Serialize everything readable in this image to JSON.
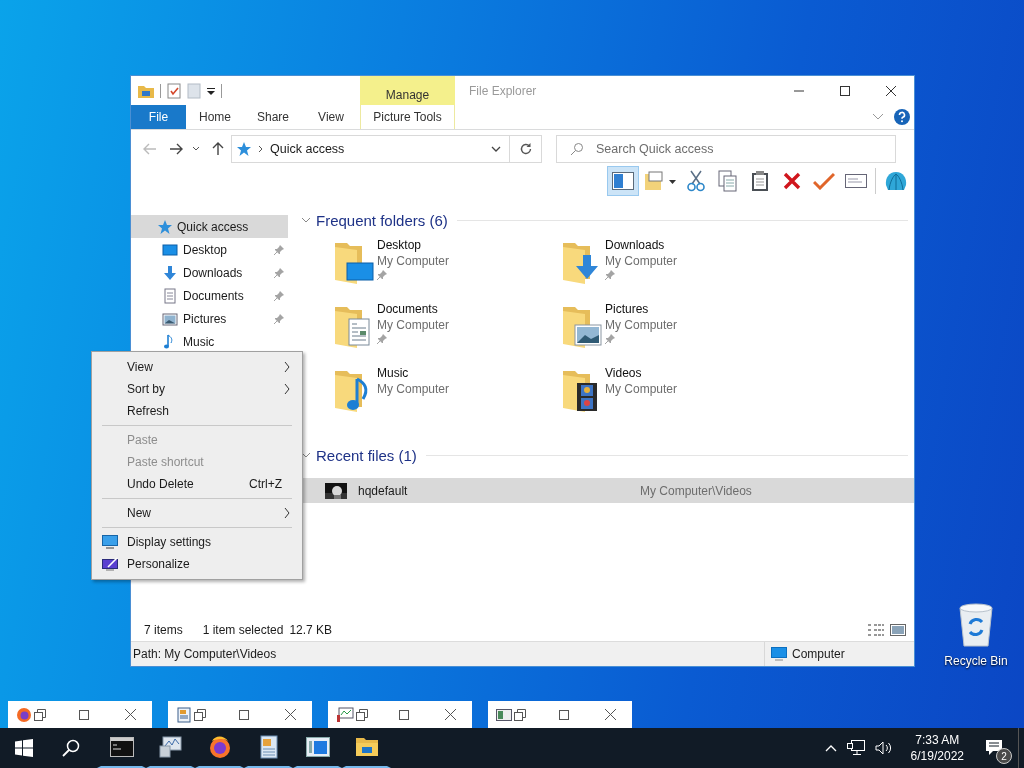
{
  "window": {
    "title": "File Explorer",
    "context_group": "Manage",
    "ribbon_tabs": [
      {
        "label": "File",
        "kind": "file"
      },
      {
        "label": "Home",
        "kind": "tab"
      },
      {
        "label": "Share",
        "kind": "tab"
      },
      {
        "label": "View",
        "kind": "tab"
      },
      {
        "label": "Picture Tools",
        "kind": "context"
      }
    ],
    "address": {
      "location": "Quick access"
    },
    "search": {
      "placeholder": "Search Quick access"
    },
    "sidebar": {
      "items": [
        {
          "label": "Quick access",
          "selected": true,
          "children": [
            {
              "label": "Desktop",
              "selected": false,
              "pinned": true
            },
            {
              "label": "Downloads",
              "selected": false,
              "pinned": true
            },
            {
              "label": "Documents",
              "selected": false,
              "pinned": true
            },
            {
              "label": "Pictures",
              "selected": false,
              "pinned": true
            },
            {
              "label": "Music",
              "selected": false
            }
          ]
        }
      ]
    },
    "frequent_folders": {
      "heading": "Frequent folders (6)",
      "items": [
        {
          "name": "Desktop",
          "location": "My Computer",
          "pinned": true
        },
        {
          "name": "Downloads",
          "location": "My Computer",
          "pinned": true
        },
        {
          "name": "Documents",
          "location": "My Computer",
          "pinned": true
        },
        {
          "name": "Pictures",
          "location": "My Computer",
          "pinned": true
        },
        {
          "name": "Music",
          "location": "My Computer"
        },
        {
          "name": "Videos",
          "location": "My Computer"
        }
      ]
    },
    "recent_files": {
      "heading": "Recent files (1)",
      "rows": [
        {
          "name": "hqdefault",
          "path": "My Computer\\Videos",
          "selected": true
        }
      ]
    },
    "status_bar": {
      "item_count": "7 items",
      "selection": "1 item selected",
      "size": "12.7 KB"
    },
    "details_bar": {
      "path": "Path: My Computer\\Videos",
      "zone": "Computer"
    }
  },
  "context_menu": {
    "items": [
      {
        "kind": "item",
        "label": "View",
        "submenu": true,
        "disabled": false
      },
      {
        "kind": "item",
        "label": "Sort by",
        "submenu": true,
        "disabled": false
      },
      {
        "kind": "item",
        "label": "Refresh",
        "submenu": false,
        "disabled": false
      },
      {
        "kind": "separator"
      },
      {
        "kind": "item",
        "label": "Paste",
        "submenu": false,
        "disabled": true
      },
      {
        "kind": "item",
        "label": "Paste shortcut",
        "submenu": false,
        "disabled": true
      },
      {
        "kind": "item",
        "label": "Undo Delete",
        "shortcut": "Ctrl+Z",
        "submenu": false,
        "disabled": false
      },
      {
        "kind": "separator"
      },
      {
        "kind": "item",
        "label": "New",
        "submenu": true,
        "disabled": false
      },
      {
        "kind": "separator"
      },
      {
        "kind": "item",
        "label": "Display settings",
        "submenu": false,
        "disabled": false
      },
      {
        "kind": "item",
        "label": "Personalize",
        "submenu": false,
        "disabled": false
      }
    ]
  },
  "desktop_icons": [
    {
      "label": "Recycle Bin"
    }
  ],
  "taskbar": {
    "time": "7:33 AM",
    "date": "6/19/2022",
    "notifications": "2"
  }
}
